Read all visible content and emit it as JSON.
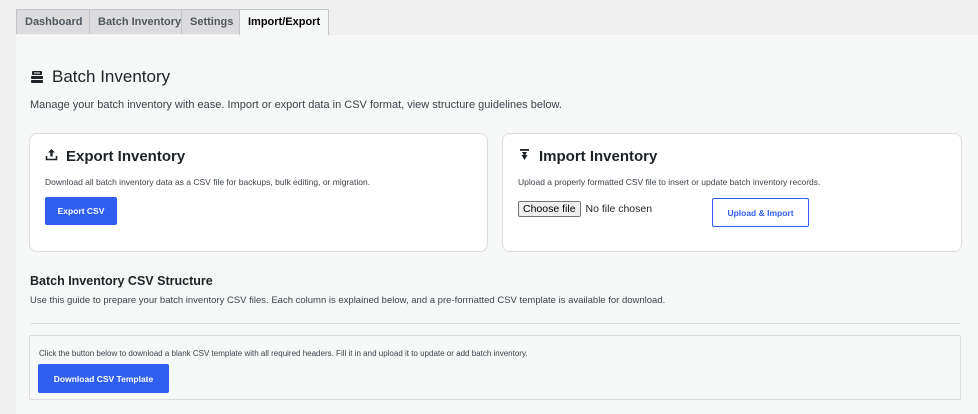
{
  "tabs": [
    {
      "label": "Dashboard",
      "active": false
    },
    {
      "label": "Batch Inventory",
      "active": false
    },
    {
      "label": "Settings",
      "active": false
    },
    {
      "label": "Import/Export",
      "active": true
    }
  ],
  "header": {
    "title": "Batch Inventory",
    "icon": "inventory-stack-icon",
    "intro": "Manage your batch inventory with ease. Import or export data in CSV format, view structure guidelines below."
  },
  "export_card": {
    "title": "Export Inventory",
    "icon": "upload-tray-icon",
    "description": "Download all batch inventory data as a CSV file for backups, bulk editing, or migration.",
    "button_label": "Export CSV"
  },
  "import_card": {
    "title": "Import Inventory",
    "icon": "download-pin-icon",
    "description": "Upload a properly formatted CSV file to insert or update batch inventory records.",
    "choose_file_label": "Choose file",
    "file_status": "No file chosen",
    "button_label": "Upload & Import"
  },
  "structure": {
    "title": "Batch Inventory CSV Structure",
    "description": "Use this guide to prepare your batch inventory CSV files. Each column is explained below, and a pre-formatted CSV template is available for download.",
    "template_text": "Click the button below to download a blank CSV template with all required headers. Fill it in and upload it to update or add batch inventory.",
    "template_button_label": "Download CSV Template"
  },
  "colors": {
    "accent": "#2f5ef0",
    "page_background": "#f0f0f1",
    "card_background": "#ffffff"
  }
}
